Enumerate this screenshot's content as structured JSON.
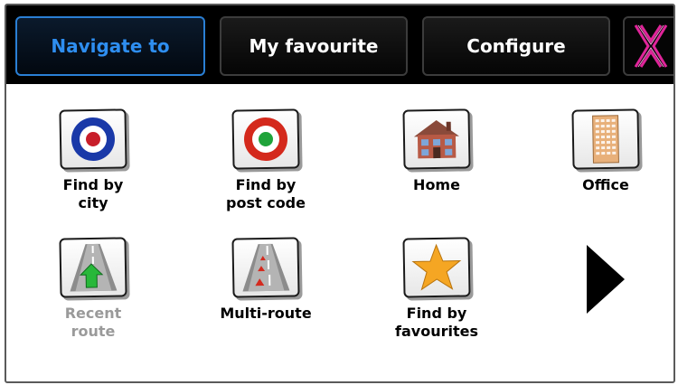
{
  "tabs": [
    {
      "label": "Navigate to",
      "active": true
    },
    {
      "label": "My favourite",
      "active": false
    },
    {
      "label": "Configure",
      "active": false
    }
  ],
  "items": [
    {
      "label": "Find by\ncity",
      "icon": "city-target-icon",
      "enabled": true
    },
    {
      "label": "Find by\npost code",
      "icon": "postcode-target-icon",
      "enabled": true
    },
    {
      "label": "Home",
      "icon": "house-icon",
      "enabled": true
    },
    {
      "label": "Office",
      "icon": "office-building-icon",
      "enabled": true
    },
    {
      "label": "Recent\nroute",
      "icon": "recent-route-icon",
      "enabled": false
    },
    {
      "label": "Multi-route",
      "icon": "multi-route-icon",
      "enabled": true
    },
    {
      "label": "Find by\nfavourites",
      "icon": "star-icon",
      "enabled": true
    }
  ],
  "colors": {
    "accent": "#2e8ef0",
    "close": "#e0249a",
    "disabled": "#9a9a9a"
  }
}
